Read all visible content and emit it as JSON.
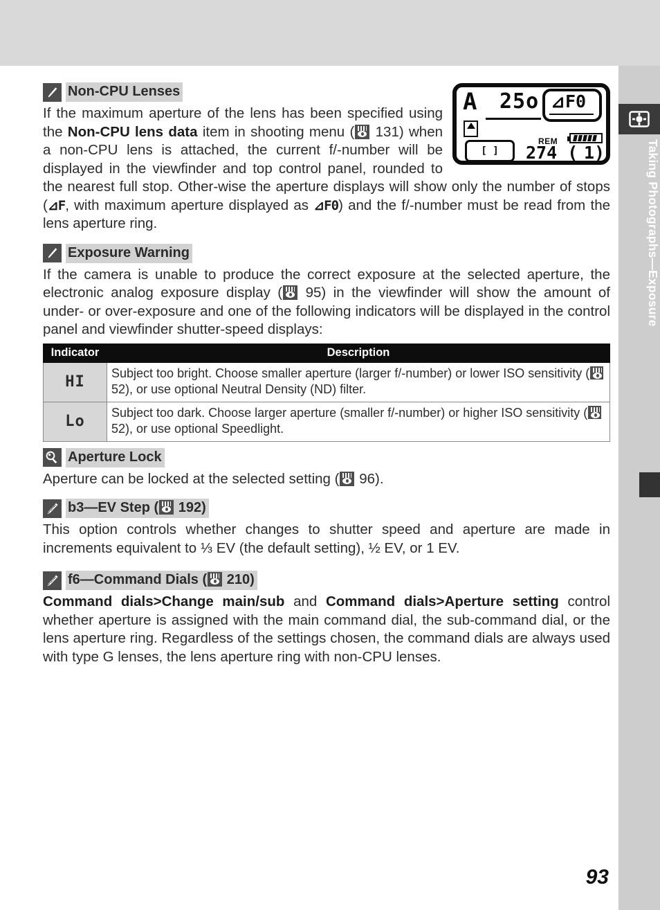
{
  "sidebar": {
    "label": "Taking Photographs—Exposure",
    "icon": "camera-focus-icon",
    "bg_color": "#cdcdcd",
    "icon_bg_color": "#3a3a3a",
    "marker_color": "#333333"
  },
  "page_number": "93",
  "lcd_panel": {
    "mode": "A",
    "shutter_speed": "25o",
    "aperture": "⊿F0",
    "rem_label": "REM",
    "frames_remaining": "274 (",
    "frames_buffer": "1)",
    "frame_icon": "[ ]",
    "battery_icon": "battery-full-icon",
    "flag_icon": "memory-card-icon"
  },
  "notes": [
    {
      "icon": "pencil-icon",
      "title": "Non-CPU Lenses",
      "body_pre": "If the maximum aperture of the lens has been specified using the ",
      "body_bold": "Non-CPU lens data",
      "body_mid": " item in shooting menu (",
      "ref_page": "131",
      "body_post": ") when a non-CPU lens is attached, the current f/-number will be displayed in the viewfinder and top control panel, rounded to the nearest full stop.  Other-wise the aperture displays will show only the number of stops (",
      "symbol_1": "⊿F",
      "body_tail_1": ", with maximum aperture displayed as ",
      "symbol_2": "⊿F0",
      "body_tail_2": ") and the f/-number must be read from the lens aperture ring."
    },
    {
      "icon": "pencil-icon",
      "title": "Exposure Warning",
      "body_pre": "If the camera is unable to produce the correct exposure at the selected aperture, the electronic analog exposure display (",
      "ref_page": "95",
      "body_post": ") in the viewfinder will show the amount of under- or over-exposure and one of the following indicators will be displayed in the control panel and viewfinder shutter-speed displays:"
    }
  ],
  "table": {
    "headers": [
      "Indicator",
      "Description"
    ],
    "rows": [
      {
        "indicator": "HI",
        "desc_pre": "Subject too bright.  Choose smaller aperture (larger f/-number) or lower ISO sensitivity (",
        "ref_page": "52",
        "desc_post": "), or use optional Neutral Density (ND) filter."
      },
      {
        "indicator": "Lo",
        "desc_pre": "Subject too dark.  Choose larger aperture (smaller f/-number) or higher ISO sensitivity (",
        "ref_page": "52",
        "desc_post": "), or use optional Speedlight."
      }
    ]
  },
  "sections": [
    {
      "icon": "tip-key-icon",
      "title": "Aperture Lock",
      "body_pre": "Aperture can be locked at the selected setting (",
      "ref_page": "96",
      "body_post": ")."
    },
    {
      "icon": "csm-icon",
      "title_pre": "b3—EV Step (",
      "ref_page": "192",
      "title_post": ")",
      "body": "This option controls whether changes to shutter speed and aperture are made in increments equivalent to ⅓ EV (the default setting), ½ EV, or 1 EV."
    },
    {
      "icon": "csm-icon",
      "title_pre": "f6—Command Dials (",
      "ref_page": "210",
      "title_post": ")",
      "body_b1": "Command dials",
      "body_gt1": ">",
      "body_b2": "Change main/sub",
      "body_mid": " and ",
      "body_b3": "Command dials",
      "body_gt2": ">",
      "body_b4": "Aperture setting",
      "body_tail": " control whether aperture is assigned with the main command dial, the sub-command dial, or the lens aperture ring.  Regardless of the settings chosen, the command dials are always used with type G lenses, the lens aperture ring with non-CPU lenses."
    }
  ]
}
